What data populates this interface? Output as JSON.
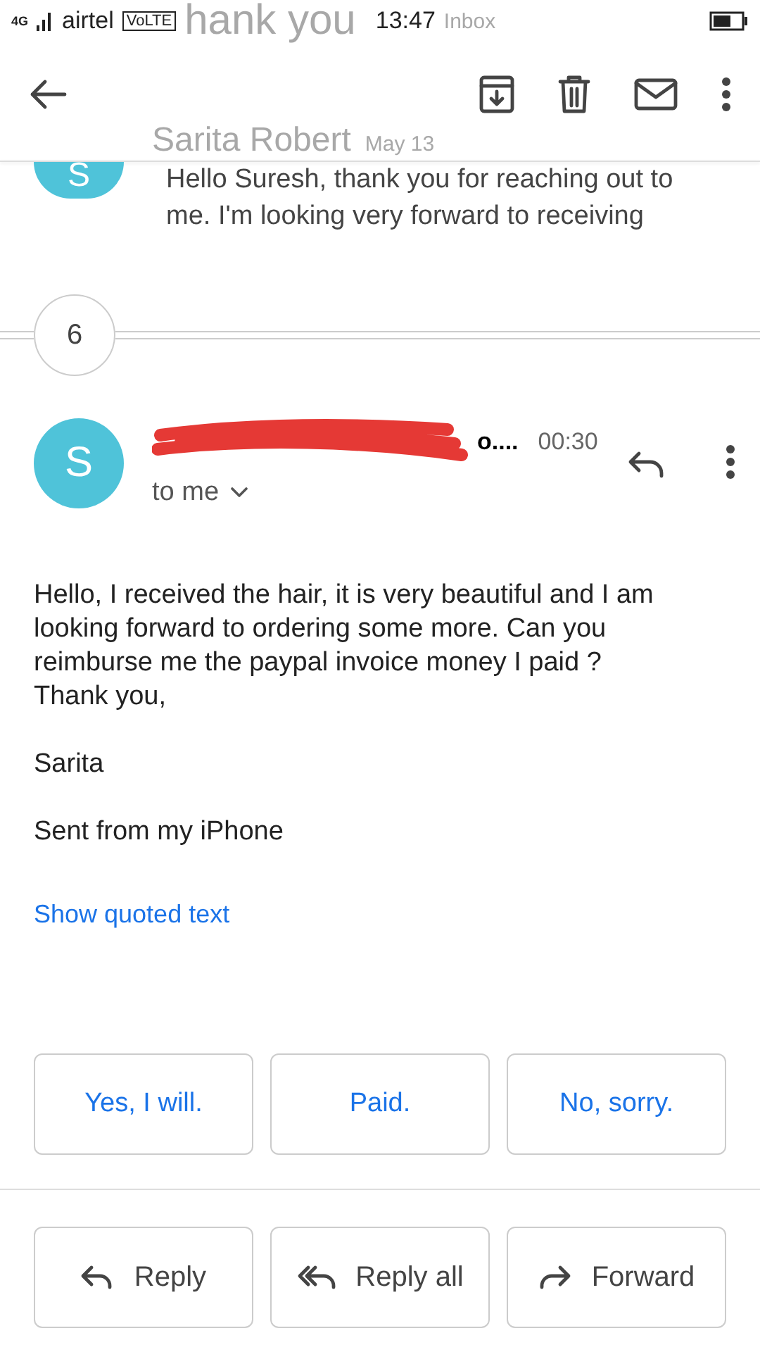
{
  "status_bar": {
    "network": "4G",
    "carrier": "airtel",
    "volte": "VoLTE",
    "ghost_subject": "hank you",
    "time": "13:47",
    "ghost_label": "Inbox"
  },
  "previous_message": {
    "avatar_letter": "S",
    "sender": "Sarita Robert",
    "date": "May 13",
    "snippet": "Hello Suresh, thank you for reaching out to me. I'm looking very forward to receiving"
  },
  "collapsed_count": "6",
  "message": {
    "avatar_letter": "S",
    "sender_visible": "o....",
    "time": "00:30",
    "recipient": "to me",
    "body": [
      "Hello, I received the hair, it is very beautiful and I am looking forward to ordering some more. Can you reimburse me the paypal invoice money I paid ?\nThank you,",
      "Sarita",
      "Sent from my iPhone"
    ],
    "quoted_link": "Show quoted text"
  },
  "smart_replies": [
    "Yes, I will.",
    "Paid.",
    "No, sorry."
  ],
  "actions": [
    {
      "kind": "reply",
      "label": "Reply"
    },
    {
      "kind": "reply_all",
      "label": "Reply all"
    },
    {
      "kind": "forward",
      "label": "Forward"
    }
  ]
}
